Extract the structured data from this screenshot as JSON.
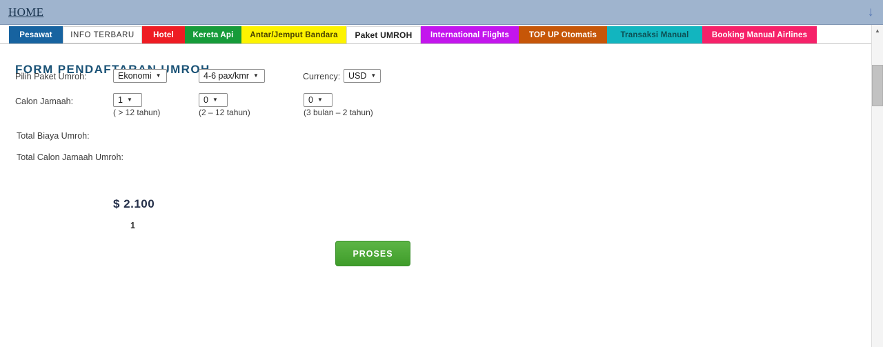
{
  "header": {
    "home_label": "HOME",
    "scroll_down_icon": "arrow-down-icon",
    "bar_color": "#9fb4ce"
  },
  "tabs": [
    {
      "label": "Pesawat",
      "color": "#1763a0",
      "active": false
    },
    {
      "label": "INFO TERBARU",
      "color": "#ffffff",
      "active": false
    },
    {
      "label": "Hotel",
      "color": "#ee1c23",
      "active": false
    },
    {
      "label": "Kereta Api",
      "color": "#169b39",
      "active": false
    },
    {
      "label": "Antar/Jemput Bandara",
      "color": "#fdf300",
      "active": false
    },
    {
      "label": "Paket UMROH",
      "color": "#ffffff",
      "active": true
    },
    {
      "label": "International Flights",
      "color": "#c315ed",
      "active": false
    },
    {
      "label": "TOP UP Otomatis",
      "color": "#c65608",
      "active": false
    },
    {
      "label": "Transaksi Manual",
      "color": "#12b5bf",
      "active": false
    },
    {
      "label": "Booking Manual Airlines",
      "color": "#f62169",
      "active": false
    }
  ],
  "form": {
    "title": "FORM PENDAFTARAN UMROH",
    "title_color": "#1a5276",
    "paket_label": "Pilih Paket Umroh:",
    "paket_value": "Ekonomi",
    "room_value": "4-6 pax/kmr",
    "currency_label": "Currency:",
    "currency_value": "USD",
    "jamaah_label": "Calon Jamaah:",
    "adult_value": "1",
    "adult_hint": "( > 12 tahun)",
    "child_value": "0",
    "child_hint": "(2 – 12 tahun)",
    "infant_value": "0",
    "infant_hint": "(3 bulan – 2 tahun)",
    "total_biaya_label": "Total Biaya Umroh:",
    "total_biaya_value": "$ 2.100",
    "total_jamaah_label": "Total Calon Jamaah Umroh:",
    "total_jamaah_value": "1",
    "submit_label": "PROSES",
    "submit_color": "#3f9c2a"
  },
  "scrollbar": {
    "up_arrow_icon": "triangle-up-icon"
  }
}
